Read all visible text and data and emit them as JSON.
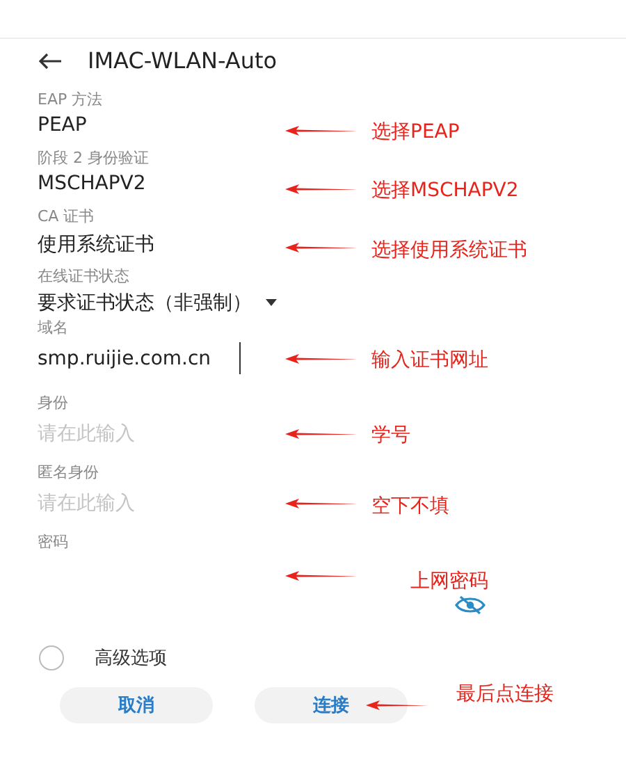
{
  "title": "IMAC-WLAN-Auto",
  "fields": [
    {
      "kind": "value",
      "label": "EAP 方法",
      "value": "PEAP",
      "note": "选择PEAP"
    },
    {
      "kind": "value",
      "label": "阶段 2 身份验证",
      "value": "MSCHAPV2",
      "note": "选择MSCHAPV2"
    },
    {
      "kind": "value",
      "label": "CA 证书",
      "value": "使用系统证书",
      "note": "选择使用系统证书"
    },
    {
      "kind": "dropdown",
      "label": "在线证书状态",
      "value": "要求证书状态（非强制）"
    },
    {
      "kind": "input",
      "label": "域名",
      "value": "smp.ruijie.com.cn",
      "note": "输入证书网址"
    },
    {
      "kind": "input",
      "label": "身份",
      "placeholder": "请在此输入",
      "note": "学号"
    },
    {
      "kind": "input",
      "label": "匿名身份",
      "placeholder": "请在此输入",
      "note": "空下不填"
    },
    {
      "kind": "password",
      "label": "密码",
      "note": "上网密码"
    }
  ],
  "advanced": {
    "label": "高级选项",
    "checked": false
  },
  "buttons": [
    {
      "label": "取消"
    },
    {
      "label": "连接",
      "note": "最后点连接"
    }
  ]
}
